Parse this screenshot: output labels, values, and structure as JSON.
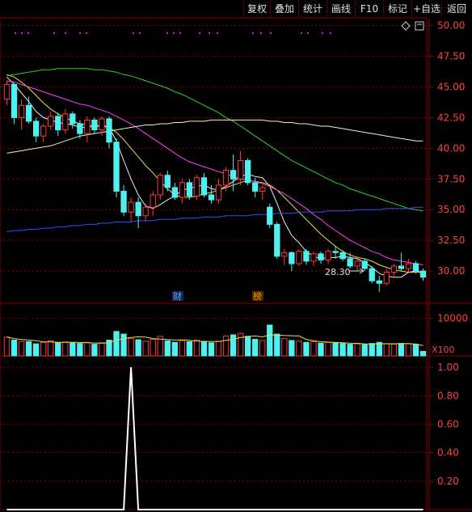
{
  "toolbar": {
    "buttons": [
      "复权",
      "叠加",
      "统计",
      "画线",
      "F10",
      "标记",
      "+自选",
      "返回"
    ]
  },
  "icons": {
    "diamond": "diamond-icon",
    "panel_box": "panel-box-icon"
  },
  "colors": {
    "background": "#000000",
    "up_candle": "#ff3b3b",
    "down_candle": "#4ff0f0",
    "ma5": "#f0f0f0",
    "ma10": "#e8e040",
    "ma20": "#ff40ff",
    "ma60": "#30d030",
    "ma250": "#3050ff",
    "grid": "#8b0000",
    "axis_text": "#ff4040",
    "indicator_line": "#ffffff",
    "annotation_marker": "#ff00ff"
  },
  "annotations": {
    "low_label": "28.30",
    "badge_cai": "财",
    "badge_bang": "榜",
    "vol_unit": "X100"
  },
  "chart_data": [
    {
      "type": "candlestick",
      "title": "",
      "y_ticks": [
        "50.00",
        "47.50",
        "45.00",
        "42.50",
        "40.00",
        "37.50",
        "35.00",
        "32.50",
        "30.00"
      ],
      "ylim": [
        27.5,
        50.5
      ],
      "low_marker": 28.3,
      "ohlc": [
        [
          44.0,
          45.5,
          43.5,
          45.2
        ],
        [
          45.2,
          45.3,
          42.0,
          42.5
        ],
        [
          42.5,
          44.0,
          41.5,
          43.5
        ],
        [
          43.5,
          44.2,
          42.0,
          42.2
        ],
        [
          42.2,
          42.5,
          40.5,
          41.0
        ],
        [
          41.0,
          42.0,
          40.5,
          41.8
        ],
        [
          41.8,
          43.0,
          41.5,
          42.6
        ],
        [
          42.6,
          42.9,
          41.0,
          41.5
        ],
        [
          41.5,
          43.2,
          41.2,
          42.8
        ],
        [
          42.8,
          43.0,
          41.6,
          42.0
        ],
        [
          42.0,
          42.3,
          40.8,
          41.2
        ],
        [
          41.2,
          42.6,
          40.5,
          42.3
        ],
        [
          42.3,
          42.5,
          41.2,
          41.5
        ],
        [
          41.5,
          42.6,
          41.0,
          42.4
        ],
        [
          42.4,
          42.6,
          40.0,
          40.5
        ],
        [
          40.5,
          40.8,
          36.0,
          36.5
        ],
        [
          36.5,
          37.0,
          34.5,
          34.8
        ],
        [
          34.8,
          36.0,
          34.0,
          35.6
        ],
        [
          35.6,
          36.0,
          33.5,
          34.5
        ],
        [
          34.5,
          35.5,
          34.0,
          35.2
        ],
        [
          35.2,
          36.5,
          34.5,
          36.2
        ],
        [
          36.2,
          38.0,
          35.8,
          37.8
        ],
        [
          37.8,
          38.2,
          36.5,
          36.8
        ],
        [
          36.8,
          37.2,
          35.8,
          36.0
        ],
        [
          36.0,
          37.5,
          35.5,
          37.2
        ],
        [
          37.2,
          37.5,
          35.8,
          36.1
        ],
        [
          36.1,
          37.8,
          35.8,
          37.6
        ],
        [
          37.6,
          38.0,
          36.0,
          36.2
        ],
        [
          36.2,
          37.0,
          35.5,
          35.8
        ],
        [
          35.8,
          37.5,
          35.5,
          37.0
        ],
        [
          37.0,
          38.5,
          36.5,
          38.2
        ],
        [
          38.2,
          39.5,
          36.5,
          37.5
        ],
        [
          37.5,
          39.8,
          37.0,
          39.0
        ],
        [
          39.0,
          39.2,
          37.0,
          37.2
        ],
        [
          37.2,
          37.6,
          36.0,
          36.5
        ],
        [
          36.5,
          37.0,
          35.8,
          36.8
        ],
        [
          35.2,
          35.5,
          33.5,
          33.8
        ],
        [
          33.8,
          34.0,
          31.0,
          31.2
        ],
        [
          31.2,
          31.8,
          30.5,
          31.5
        ],
        [
          31.5,
          31.6,
          30.0,
          30.6
        ],
        [
          30.6,
          31.8,
          30.4,
          31.6
        ],
        [
          31.6,
          31.8,
          30.5,
          30.8
        ],
        [
          30.8,
          31.6,
          30.4,
          31.4
        ],
        [
          31.4,
          31.6,
          30.6,
          30.9
        ],
        [
          30.9,
          31.8,
          30.6,
          31.6
        ],
        [
          31.6,
          32.0,
          31.0,
          31.5
        ],
        [
          31.5,
          31.7,
          30.8,
          31.0
        ],
        [
          31.0,
          31.5,
          30.2,
          30.4
        ],
        [
          30.4,
          31.2,
          30.0,
          30.8
        ],
        [
          30.8,
          31.0,
          30.0,
          30.2
        ],
        [
          30.2,
          30.4,
          29.0,
          29.2
        ],
        [
          29.2,
          29.6,
          28.3,
          29.0
        ],
        [
          29.0,
          30.2,
          28.8,
          29.9
        ],
        [
          29.9,
          30.6,
          29.6,
          30.4
        ],
        [
          30.4,
          31.5,
          30.0,
          30.2
        ],
        [
          30.2,
          31.0,
          29.8,
          30.6
        ],
        [
          30.6,
          30.8,
          29.8,
          30.0
        ],
        [
          30.0,
          30.2,
          29.2,
          29.5
        ]
      ],
      "ma_lines": [
        {
          "key": "ma5",
          "values": [
            45.8,
            45.2,
            44.5,
            43.8,
            43.0,
            42.5,
            42.3,
            42.1,
            42.0,
            41.9,
            41.7,
            41.7,
            41.8,
            41.9,
            41.7,
            40.6,
            39.0,
            37.5,
            36.2,
            35.3,
            35.1,
            35.4,
            35.8,
            36.1,
            36.6,
            36.7,
            36.9,
            37.0,
            36.7,
            36.6,
            36.9,
            37.3,
            37.7,
            37.9,
            37.7,
            37.6,
            36.9,
            35.5,
            34.0,
            32.9,
            32.3,
            31.6,
            31.2,
            31.0,
            31.1,
            31.1,
            31.2,
            31.1,
            31.0,
            30.7,
            30.3,
            29.8,
            29.6,
            29.5,
            29.5,
            29.9,
            30.0,
            29.9
          ]
        },
        {
          "key": "ma10",
          "values": [
            46.0,
            45.8,
            45.4,
            44.9,
            44.3,
            43.7,
            43.2,
            42.8,
            42.5,
            42.2,
            42.0,
            41.9,
            41.8,
            41.8,
            41.7,
            41.3,
            40.7,
            40.0,
            39.3,
            38.6,
            38.0,
            37.3,
            36.7,
            36.2,
            36.0,
            36.0,
            36.1,
            36.3,
            36.4,
            36.6,
            36.8,
            37.0,
            37.2,
            37.4,
            37.3,
            37.2,
            37.0,
            36.6,
            36.0,
            35.4,
            34.8,
            34.2,
            33.6,
            33.0,
            32.5,
            32.0,
            31.6,
            31.3,
            31.1,
            31.0,
            30.8,
            30.5,
            30.3,
            30.1,
            30.0,
            29.9,
            29.9,
            29.9
          ]
        },
        {
          "key": "ma20",
          "values": [
            45.5,
            45.4,
            45.2,
            45.0,
            44.8,
            44.6,
            44.4,
            44.2,
            44.0,
            43.8,
            43.6,
            43.5,
            43.3,
            43.1,
            42.9,
            42.6,
            42.3,
            42.0,
            41.6,
            41.2,
            40.8,
            40.4,
            40.0,
            39.6,
            39.2,
            38.9,
            38.7,
            38.5,
            38.3,
            38.1,
            37.9,
            37.7,
            37.5,
            37.4,
            37.3,
            37.1,
            36.9,
            36.6,
            36.3,
            35.9,
            35.5,
            35.1,
            34.6,
            34.2,
            33.7,
            33.3,
            32.9,
            32.5,
            32.2,
            31.9,
            31.6,
            31.4,
            31.1,
            30.9,
            30.8,
            30.7,
            30.6,
            30.5
          ]
        },
        {
          "key": "ma60",
          "values": [
            45.9,
            46.0,
            46.1,
            46.2,
            46.3,
            46.4,
            46.4,
            46.5,
            46.5,
            46.5,
            46.5,
            46.5,
            46.4,
            46.4,
            46.3,
            46.2,
            46.0,
            45.9,
            45.7,
            45.5,
            45.3,
            45.1,
            44.9,
            44.6,
            44.4,
            44.1,
            43.8,
            43.5,
            43.2,
            42.9,
            42.5,
            42.2,
            41.8,
            41.4,
            41.0,
            40.6,
            40.2,
            39.8,
            39.4,
            39.0,
            38.7,
            38.4,
            38.1,
            37.8,
            37.5,
            37.2,
            37.0,
            36.7,
            36.5,
            36.3,
            36.1,
            35.9,
            35.7,
            35.5,
            35.3,
            35.1,
            35.0,
            34.9
          ]
        },
        {
          "key": "ma250",
          "values": [
            33.2,
            33.3,
            33.3,
            33.4,
            33.4,
            33.5,
            33.5,
            33.6,
            33.6,
            33.7,
            33.7,
            33.8,
            33.8,
            33.9,
            33.9,
            34.0,
            34.0,
            34.0,
            34.1,
            34.1,
            34.1,
            34.2,
            34.2,
            34.2,
            34.3,
            34.3,
            34.3,
            34.4,
            34.4,
            34.4,
            34.5,
            34.5,
            34.5,
            34.5,
            34.6,
            34.6,
            34.6,
            34.7,
            34.7,
            34.7,
            34.8,
            34.8,
            34.8,
            34.8,
            34.9,
            34.9,
            34.9,
            34.9,
            35.0,
            35.0,
            35.0,
            35.0,
            35.1,
            35.1,
            35.1,
            35.1,
            35.2,
            35.2
          ]
        },
        {
          "key": "ma5",
          "alt": "long_white",
          "values": [
            39.6,
            39.7,
            39.8,
            39.9,
            40.0,
            40.1,
            40.2,
            40.4,
            40.6,
            40.8,
            41.0,
            41.1,
            41.2,
            41.3,
            41.4,
            41.5,
            41.6,
            41.7,
            41.8,
            41.9,
            41.9,
            42.0,
            42.0,
            42.1,
            42.1,
            42.2,
            42.2,
            42.2,
            42.3,
            42.3,
            42.3,
            42.3,
            42.3,
            42.3,
            42.3,
            42.3,
            42.2,
            42.2,
            42.1,
            42.1,
            42.0,
            42.0,
            41.9,
            41.8,
            41.8,
            41.7,
            41.6,
            41.5,
            41.4,
            41.3,
            41.2,
            41.1,
            41.0,
            40.9,
            40.8,
            40.7,
            40.6,
            40.6
          ]
        }
      ]
    },
    {
      "type": "bar",
      "title": "",
      "y_ticks": [
        "10000"
      ],
      "ylim": [
        0,
        14000
      ],
      "values": [
        5000,
        4200,
        3900,
        3800,
        3200,
        3600,
        4000,
        3500,
        3700,
        3400,
        3300,
        3600,
        3100,
        3500,
        4200,
        6500,
        5800,
        4600,
        4300,
        3900,
        4400,
        5200,
        4000,
        3600,
        4100,
        3800,
        4200,
        3700,
        3500,
        3900,
        5300,
        5600,
        6000,
        5200,
        4400,
        4100,
        8200,
        5800,
        4600,
        4100,
        3900,
        3600,
        3800,
        3400,
        3600,
        3500,
        3300,
        3100,
        3200,
        3000,
        3300,
        3600,
        3200,
        3100,
        3300,
        3200,
        3000,
        1200
      ],
      "up": [
        1,
        0,
        1,
        0,
        0,
        1,
        1,
        0,
        1,
        0,
        0,
        1,
        0,
        1,
        0,
        0,
        0,
        1,
        0,
        1,
        1,
        1,
        0,
        0,
        1,
        0,
        1,
        0,
        0,
        1,
        1,
        0,
        1,
        0,
        0,
        1,
        0,
        0,
        1,
        0,
        1,
        0,
        1,
        0,
        1,
        0,
        0,
        0,
        1,
        0,
        0,
        0,
        1,
        1,
        0,
        1,
        0,
        0
      ]
    },
    {
      "type": "line",
      "title": "",
      "y_ticks": [
        "1.00",
        "0.80",
        "0.60",
        "0.40",
        "0.20"
      ],
      "ylim": [
        0,
        1.08
      ],
      "values": [
        0,
        0,
        0,
        0,
        0,
        0,
        0,
        0,
        0,
        0,
        0,
        0,
        0,
        0,
        0,
        0,
        0,
        1.0,
        0,
        0,
        0,
        0,
        0,
        0,
        0,
        0,
        0,
        0,
        0,
        0,
        0,
        0,
        0,
        0,
        0,
        0,
        0,
        0,
        0,
        0,
        0,
        0,
        0,
        0,
        0,
        0,
        0,
        0,
        0,
        0,
        0,
        0,
        0,
        0,
        0,
        0,
        0,
        0
      ]
    }
  ]
}
